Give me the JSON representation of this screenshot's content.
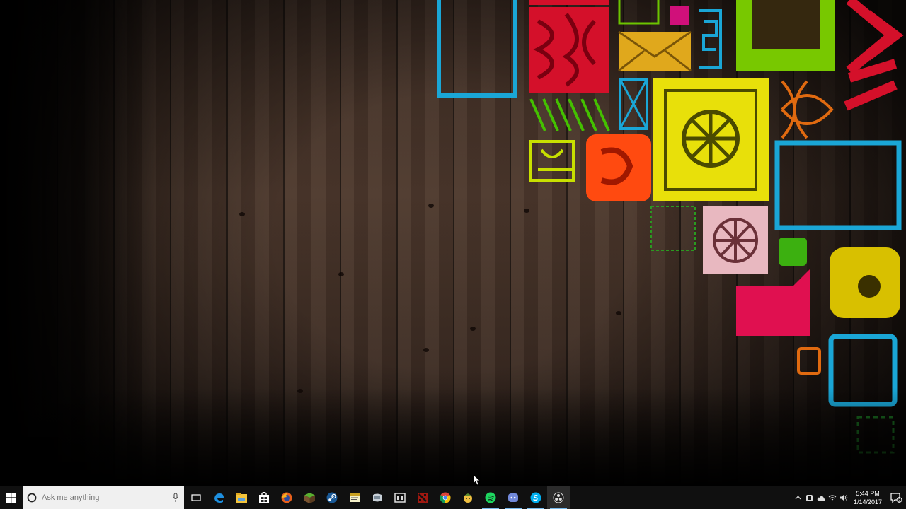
{
  "taskbar": {
    "search_placeholder": "Ask me anything",
    "pinned": [
      {
        "name": "edge-icon",
        "running": false
      },
      {
        "name": "file-explorer-icon",
        "running": false
      },
      {
        "name": "store-icon",
        "running": false
      },
      {
        "name": "firefox-icon",
        "running": false
      },
      {
        "name": "minecraft-icon",
        "running": false
      },
      {
        "name": "steam-icon",
        "running": false
      },
      {
        "name": "sticky-app-icon",
        "running": false
      },
      {
        "name": "game-app-icon",
        "running": false
      },
      {
        "name": "video-editor-icon",
        "running": false
      },
      {
        "name": "dota-icon",
        "running": false
      },
      {
        "name": "chrome-icon",
        "running": false
      },
      {
        "name": "character-app-icon",
        "running": false
      },
      {
        "name": "spotify-icon",
        "running": true
      },
      {
        "name": "discord-icon",
        "running": true
      },
      {
        "name": "skype-icon",
        "running": true
      },
      {
        "name": "obs-icon",
        "running": true
      }
    ],
    "clock": {
      "time": "5:44 PM",
      "date": "1/14/2017"
    },
    "notification_count": "2",
    "accent": "#76b9ed"
  }
}
